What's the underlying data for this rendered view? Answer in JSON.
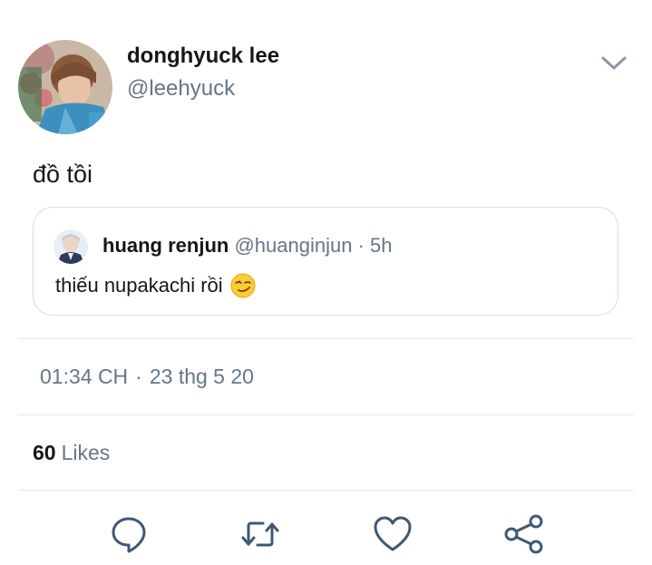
{
  "tweet": {
    "author": {
      "display_name": "donghyuck lee",
      "handle": "@leehyuck"
    },
    "text": "đồ tồi",
    "quoted": {
      "author_name": "huang renjun",
      "author_handle": "@huanginjun",
      "separator": "·",
      "time": "5h",
      "text": "thiếu nupakachi rồi"
    },
    "timestamp": {
      "time": "01:34 CH",
      "separator": "·",
      "date": "23 thg 5 20"
    },
    "likes": {
      "count": "60",
      "label": "Likes"
    }
  },
  "icons": {
    "caret": "chevron-down-icon",
    "reply": "reply-icon",
    "retweet": "retweet-icon",
    "like": "heart-icon",
    "share": "share-icon",
    "emoji": "smirking-face-emoji"
  },
  "colors": {
    "text_primary": "#14171a",
    "text_secondary": "#657786",
    "icon": "#3e5a73",
    "border": "#d6dde3",
    "divider": "#e1e8ed"
  }
}
